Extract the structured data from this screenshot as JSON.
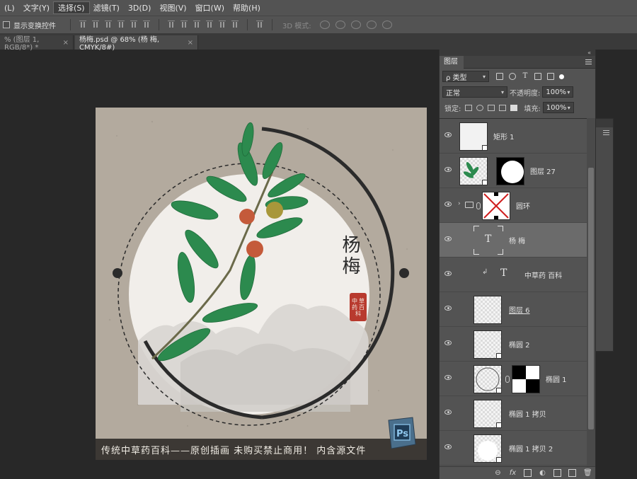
{
  "menu": {
    "items": [
      "(L)",
      "文字(Y)",
      "选择(S)",
      "滤镜(T)",
      "3D(D)",
      "视图(V)",
      "窗口(W)",
      "帮助(H)"
    ],
    "active_index": 2
  },
  "options": {
    "show_transform_label": "显示变换控件",
    "mode3d_label": "3D 模式:"
  },
  "tabs": [
    {
      "label": "% (图层 1, RGB/8*) *",
      "close": "×"
    },
    {
      "label": "杨梅.psd @ 68% (杨 梅, CMYK/8#)",
      "close": "×"
    }
  ],
  "artwork": {
    "title": "杨梅",
    "seal_chars": [
      "中",
      "草",
      "药",
      "百",
      "科"
    ],
    "banner": "传统中草药百科——原创插画 未购买禁止商用！ 内含源文件",
    "ps_badge": "Ps"
  },
  "layers_panel": {
    "collapse": "«",
    "tab_label": "图层",
    "filter": {
      "value": "ρ 类型"
    },
    "blend": {
      "mode": "正常",
      "opacity_label": "不透明度:",
      "opacity": "100%"
    },
    "lock": {
      "label": "锁定:",
      "fill_label": "填充:",
      "fill": "100%"
    },
    "layers": [
      {
        "name": "矩形 1"
      },
      {
        "name": "图层 27"
      },
      {
        "name": "圆环"
      },
      {
        "name": "杨 梅",
        "selected": true
      },
      {
        "name": "中草药 百科"
      },
      {
        "name": "图层 6"
      },
      {
        "name": "椭圆 2"
      },
      {
        "name": "椭圆 1"
      },
      {
        "name": "椭圆 1 拷贝"
      },
      {
        "name": "椭圆 1 拷贝 2"
      }
    ],
    "footer_icons": [
      "link-icon",
      "fx-icon",
      "mask-icon",
      "adjustment-icon",
      "group-icon",
      "new-layer-icon",
      "trash-icon"
    ]
  },
  "colors": {
    "ui_bg": "#535353",
    "canvas_bg": "#282828",
    "paper": "#b3aa9e",
    "seal_red": "#b83a2e",
    "leaf_green": "#2c8a4e"
  }
}
